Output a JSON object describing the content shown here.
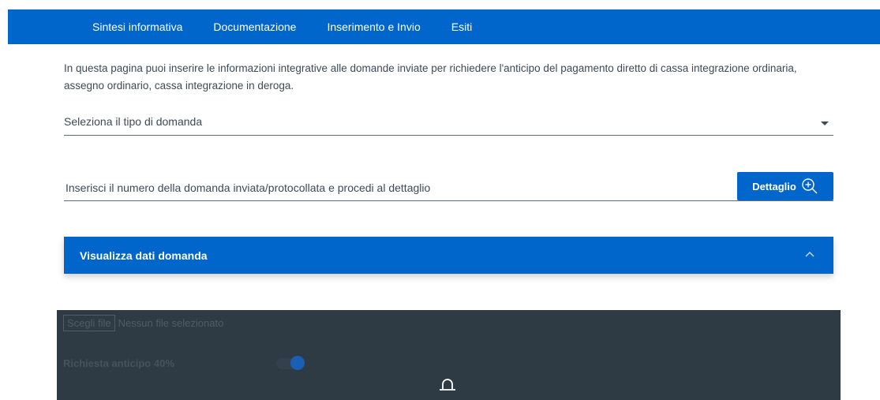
{
  "nav": {
    "items": [
      "Sintesi informativa",
      "Documentazione",
      "Inserimento e Invio",
      "Esiti"
    ]
  },
  "intro": {
    "text": "In questa pagina puoi inserire le informazioni integrative alle domande inviate per richiedere l'anticipo del pagamento diretto di cassa integrazione ordinaria, assegno ordinario, cassa integrazione in deroga."
  },
  "tipo_domanda": {
    "label": "Seleziona il tipo di domanda"
  },
  "numero_domanda": {
    "placeholder": "Inserisci il numero della domanda inviata/protocollata e procedi al dettaglio"
  },
  "dettaglio_button": {
    "label": "Dettaglio"
  },
  "accordion": {
    "title": "Visualizza dati domanda"
  },
  "upload": {
    "button_label": "Scegli file",
    "status": "Nessun file selezionato"
  },
  "anticipo": {
    "label": "Richiesta anticipo 40%"
  },
  "colors": {
    "primary": "#0066cc",
    "overlay": "#2f3b44"
  }
}
